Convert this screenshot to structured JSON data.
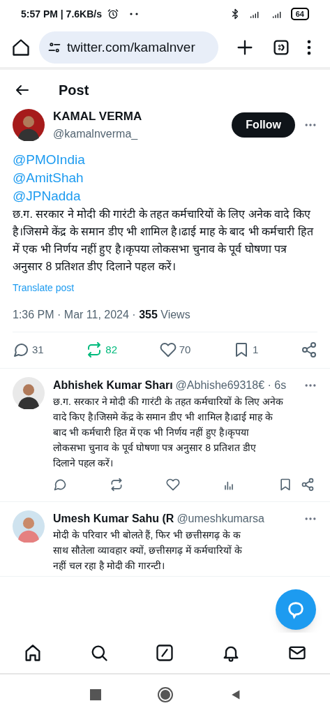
{
  "status_bar": {
    "time": "5:57 PM | 7.6KB/s",
    "battery": "64"
  },
  "browser": {
    "url": "twitter.com/kamalnver"
  },
  "header": {
    "title": "Post"
  },
  "post": {
    "name": "KAMAL VERMA",
    "handle": "@kamalnverma_",
    "follow": "Follow",
    "mentions": [
      "@PMOIndia",
      "@AmitShah",
      "@JPNadda"
    ],
    "text": "छ.ग. सरकार ने मोदी की गारंटी के तहत कर्मचारियों के लिए अनेक वादे किए है।जिसमे केंद्र के समान डीए भी शामिल है।ढाई माह के बाद भी कर्मचारी हित में एक भी निर्णय नहीं हुए है।कृपया लोकसभा चुनाव के पूर्व घोषणा पत्र अनुसार 8 प्रतिशत डीए दिलाने पहल करें।",
    "translate": "Translate post",
    "time": "1:36 PM · Mar 11, 2024 · ",
    "views_count": "355",
    "views_label": " Views",
    "actions": {
      "replies": "31",
      "reposts": "82",
      "reposted": true,
      "likes": "70",
      "bookmarks": "1"
    }
  },
  "replies": [
    {
      "name": "Abhishek Kumar Sharı",
      "handle": "@Abhishe69318€ · 6s",
      "lines": [
        "छ.ग. सरकार ने मोदी की गारंटी के तहत कर्मचारियों के लिए अनेक",
        "वादे किए है।जिसमे केंद्र के समान डीए भी शामिल है।ढाई माह के",
        "बाद भी कर्मचारी हित में एक भी निर्णय नहीं हुए है।कृपया",
        "लोकसभा चुनाव के पूर्व घोषणा पत्र अनुसार 8 प्रतिशत डीए",
        "दिलाने पहल करें।"
      ],
      "show_actions": true
    },
    {
      "name": "Umesh Kumar Sahu (R",
      "handle": "@umeshkumarsa",
      "lines": [
        "मोदी के परिवार भी बोलते हैं, फिर भी छत्तीसगढ़ के क",
        "साथ सौतेला व्यावहार क्यों, छत्तीसगढ़ में कर्मचारियों के",
        "नहीं चल रहा है मोदी की गारन्टी।"
      ],
      "show_actions": false
    }
  ]
}
